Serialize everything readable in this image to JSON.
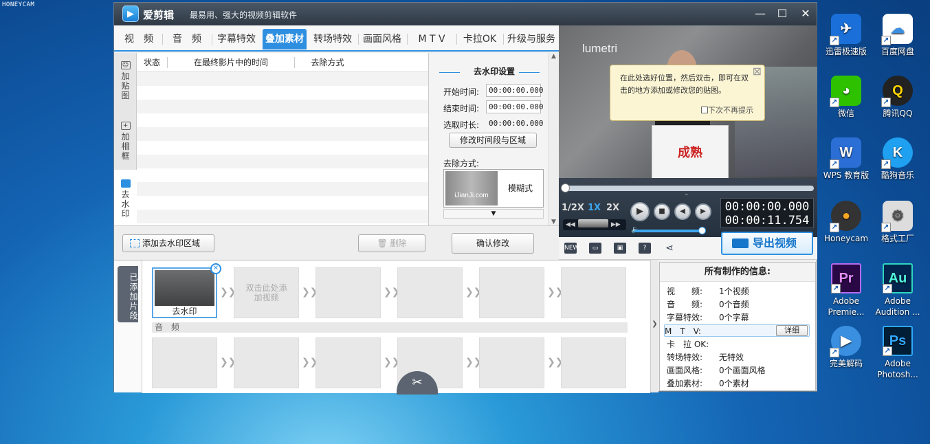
{
  "watermark": "HONEYCAM",
  "window": {
    "app_name": "爱剪辑",
    "slogan": "最易用、强大的视频剪辑软件",
    "minimize": "—",
    "maximize": "☐",
    "close": "✕"
  },
  "tabs": [
    {
      "label": "视　频"
    },
    {
      "label": "音　频"
    },
    {
      "label": "字幕特效"
    },
    {
      "label": "叠加素材"
    },
    {
      "label": "转场特效"
    },
    {
      "label": "画面风格"
    },
    {
      "label": "M T V"
    },
    {
      "label": "卡拉OK"
    },
    {
      "label": "升级与服务"
    }
  ],
  "side_tabs": [
    {
      "label": "加贴图"
    },
    {
      "label": "加相框"
    },
    {
      "label": "去水印"
    }
  ],
  "list": {
    "headers": [
      "状态",
      "在最终影片中的时间",
      "去除方式"
    ],
    "add_button": "添加去水印区域",
    "delete_button": "删除"
  },
  "watermark_settings": {
    "title": "去水印设置",
    "start_label": "开始时间:",
    "start_value": "00:00:00.000",
    "end_label": "结束时间:",
    "end_value": "00:00:00.000",
    "duration_label": "选取时长:",
    "duration_value": "00:00:00.000",
    "modify_button": "修改时间段与区域",
    "method_label": "去除方式:",
    "method_preview_text": "iJianJi.com",
    "method_value": "模糊式",
    "confirm_button": "确认修改"
  },
  "preview": {
    "overlay_text": "lumetri",
    "placard_text": "成熟",
    "tip_text": "在此处选好位置，然后双击，即可在双击的地方添加或修改您的贴图。",
    "tip_checkbox": "下次不再提示"
  },
  "player": {
    "speeds": [
      "1/2X",
      "1X",
      "2X"
    ],
    "current_time": "00:00:00.000",
    "total_time": "00:00:11.754",
    "progress": 0,
    "volume": 1
  },
  "toolbar": {
    "export_button": "导出视频"
  },
  "clips": {
    "added_label": "已添加片段",
    "first_clip_label": "去水印",
    "empty_hint": "双击此处添加视频",
    "audio_label": "音 频"
  },
  "info": {
    "title": "所有制作的信息:",
    "rows": [
      {
        "key": "视　　频:",
        "value": "1个视频"
      },
      {
        "key": "音　　频:",
        "value": "0个音频"
      },
      {
        "key": "字幕特效:",
        "value": "0个字幕"
      },
      {
        "key": "M　T　V:",
        "value": ""
      },
      {
        "key": "卡　拉 OK:",
        "value": ""
      },
      {
        "key": "转场特效:",
        "value": "无特效"
      },
      {
        "key": "画面风格:",
        "value": "0个画面风格"
      },
      {
        "key": "叠加素材:",
        "value": "0个素材"
      }
    ],
    "detail_button": "详细"
  },
  "desktop_icons": [
    {
      "label": "迅雷极速版",
      "color": "#1a6fd8",
      "glyph": "✈"
    },
    {
      "label": "百度网盘",
      "color": "#ffffff",
      "glyph": "☁"
    },
    {
      "label": "微信",
      "color": "#2dc100",
      "glyph": "💬"
    },
    {
      "label": "腾讯QQ",
      "color": "#f3f3f3",
      "glyph": "🐧"
    },
    {
      "label": "WPS 教育版",
      "color": "#2b6fd6",
      "glyph": "W"
    },
    {
      "label": "酷狗音乐",
      "color": "#1fa0f0",
      "glyph": "K"
    },
    {
      "label": "Honeycam",
      "color": "#333333",
      "glyph": "●"
    },
    {
      "label": "格式工厂",
      "color": "#dddddd",
      "glyph": "⚙"
    },
    {
      "label": "Adobe Premie...",
      "color": "#2a0845",
      "glyph": "Pr"
    },
    {
      "label": "Adobe Audition ...",
      "color": "#00264d",
      "glyph": "Au"
    },
    {
      "label": "完美解码",
      "color": "#3a8fe0",
      "glyph": "▶"
    },
    {
      "label": "Adobe Photosh...",
      "color": "#001e36",
      "glyph": "Ps"
    }
  ]
}
